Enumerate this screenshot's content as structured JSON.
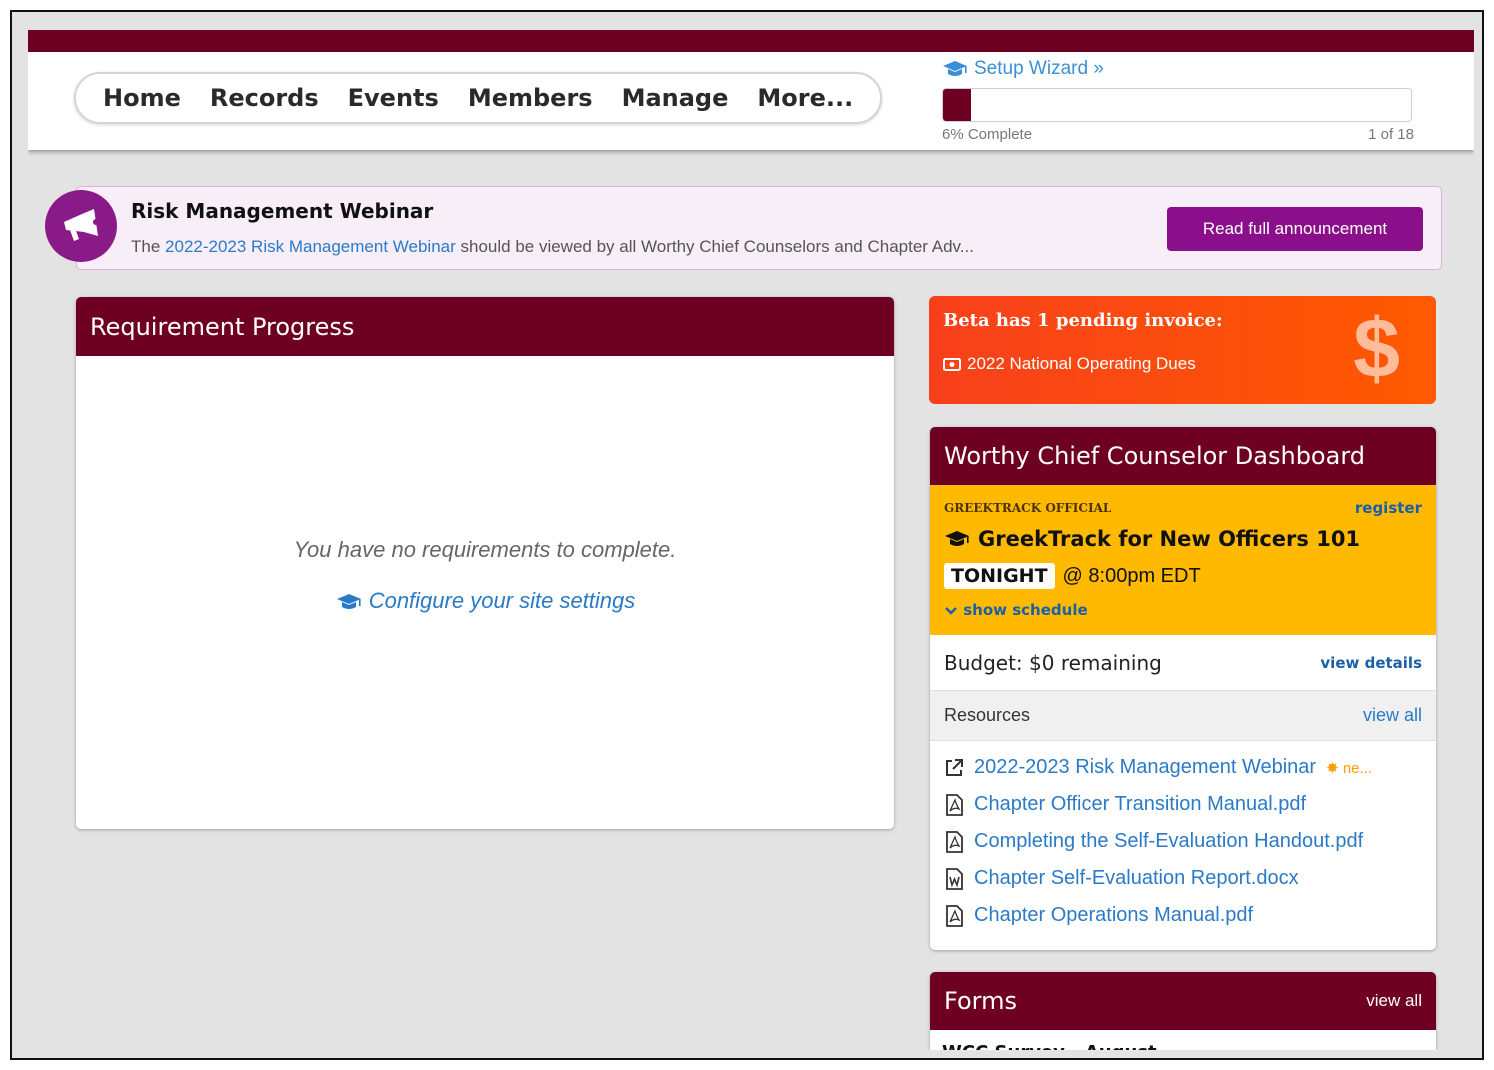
{
  "nav": {
    "items": [
      {
        "label": "Home"
      },
      {
        "label": "Records"
      },
      {
        "label": "Events"
      },
      {
        "label": "Members"
      },
      {
        "label": "Manage"
      },
      {
        "label": "More..."
      }
    ]
  },
  "wizard": {
    "link_label": "Setup Wizard »",
    "progress_percent": 6,
    "complete_text": "6% Complete",
    "step_text": "1 of 18"
  },
  "announcement": {
    "title": "Risk Management Webinar",
    "body_prefix": "The ",
    "body_link": "2022-2023 Risk Management Webinar",
    "body_suffix": " should be viewed by all Worthy Chief Counselors and Chapter Adv...",
    "button_label": "Read full announcement",
    "icon": "megaphone-icon"
  },
  "requirements": {
    "title": "Requirement Progress",
    "empty_text": "You have no requirements to complete.",
    "config_link": "Configure your site settings"
  },
  "invoice": {
    "title": "Beta has 1 pending invoice:",
    "item": "2022 National Operating Dues",
    "symbol": "$"
  },
  "dashboard": {
    "title": "Worthy Chief Counselor Dashboard",
    "event": {
      "label": "GREEKTRACK OFFICIAL",
      "register": "register",
      "title": "GreekTrack for New Officers 101",
      "badge": "TONIGHT",
      "time": "@ 8:00pm EDT",
      "schedule_link": "show schedule"
    },
    "budget": {
      "text": "Budget: $0 remaining",
      "link": "view details"
    },
    "resources": {
      "title": "Resources",
      "view_all": "view all",
      "items": [
        {
          "label": "2022-2023 Risk Management Webinar",
          "icon": "external-link-icon",
          "badge": "ne..."
        },
        {
          "label": "Chapter Officer Transition Manual.pdf",
          "icon": "pdf-file-icon"
        },
        {
          "label": "Completing the Self-Evaluation Handout.pdf",
          "icon": "pdf-file-icon"
        },
        {
          "label": "Chapter Self-Evaluation Report.docx",
          "icon": "word-file-icon"
        },
        {
          "label": "Chapter Operations Manual.pdf",
          "icon": "pdf-file-icon"
        }
      ]
    }
  },
  "forms": {
    "title": "Forms",
    "view_all": "view all",
    "first_item": "WCC Survey - August"
  },
  "colors": {
    "brand": "#6e0022",
    "accent_purple": "#8b0f8a",
    "invoice_orange": "#ff5a00",
    "event_yellow": "#ffb900",
    "link_blue": "#2a7ac7"
  }
}
